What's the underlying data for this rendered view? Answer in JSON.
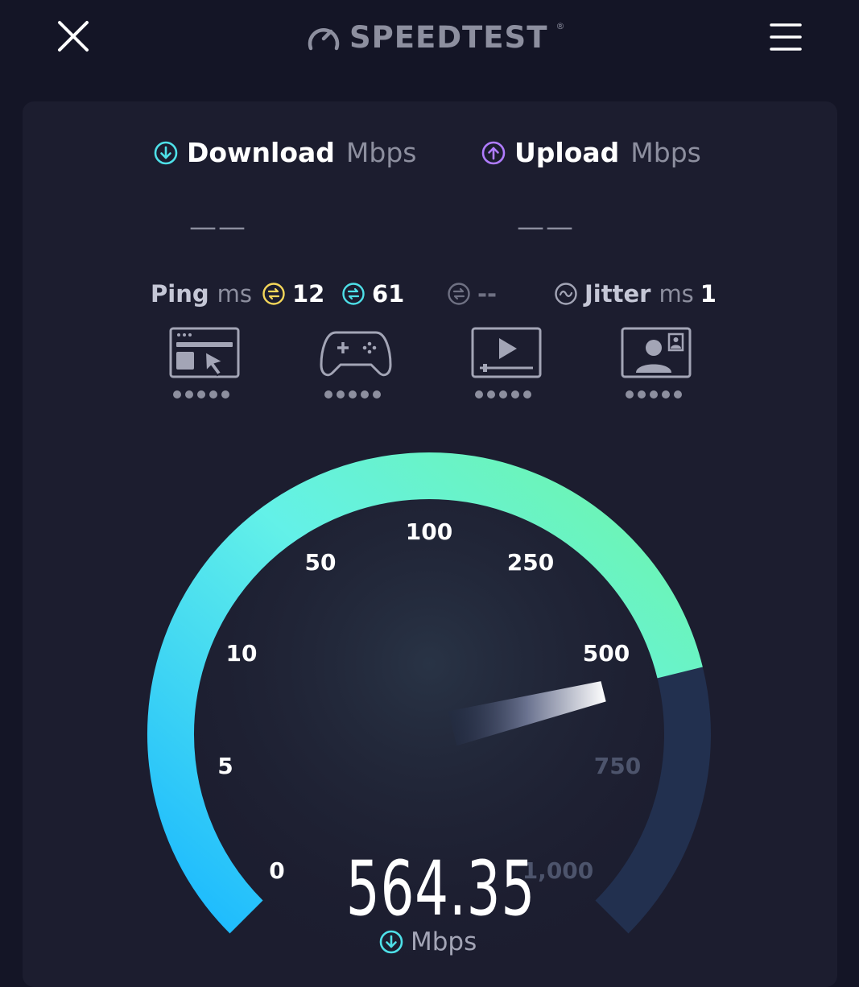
{
  "header": {
    "close_icon": "close-icon",
    "logo_icon": "gauge-logo-icon",
    "logo_text": "SPEEDTEST",
    "logo_mark": "®",
    "menu_icon": "hamburger-menu-icon"
  },
  "download": {
    "icon": "download-arrow-icon",
    "label": "Download",
    "unit": "Mbps",
    "value": "——",
    "color": "#4ee0e8"
  },
  "upload": {
    "icon": "upload-arrow-icon",
    "label": "Upload",
    "unit": "Mbps",
    "value": "——",
    "color": "#b07cff"
  },
  "ping": {
    "label": "Ping",
    "unit": "ms",
    "idle": {
      "icon": "ping-idle-icon",
      "value": "12",
      "color": "#f5d75a"
    },
    "download": {
      "icon": "ping-download-icon",
      "value": "61",
      "color": "#4ee0e8"
    },
    "upload": {
      "icon": "ping-upload-icon",
      "value": "--",
      "color": "#6f7183"
    }
  },
  "jitter": {
    "icon": "jitter-icon",
    "label": "Jitter",
    "unit": "ms",
    "value": "1"
  },
  "apps": [
    {
      "icon": "web-browsing-icon"
    },
    {
      "icon": "gaming-controller-icon"
    },
    {
      "icon": "video-streaming-icon"
    },
    {
      "icon": "video-call-icon"
    }
  ],
  "gauge": {
    "ticks": [
      "0",
      "5",
      "10",
      "50",
      "100",
      "250",
      "500",
      "750",
      "1,000"
    ],
    "value": 564.35,
    "max": 1000,
    "readout": "564.35",
    "unit": "Mbps",
    "unit_icon": "download-arrow-icon",
    "gradient_start": "#1ab8ff",
    "gradient_end": "#6ff5a8",
    "remaining_color": "#22304f"
  }
}
